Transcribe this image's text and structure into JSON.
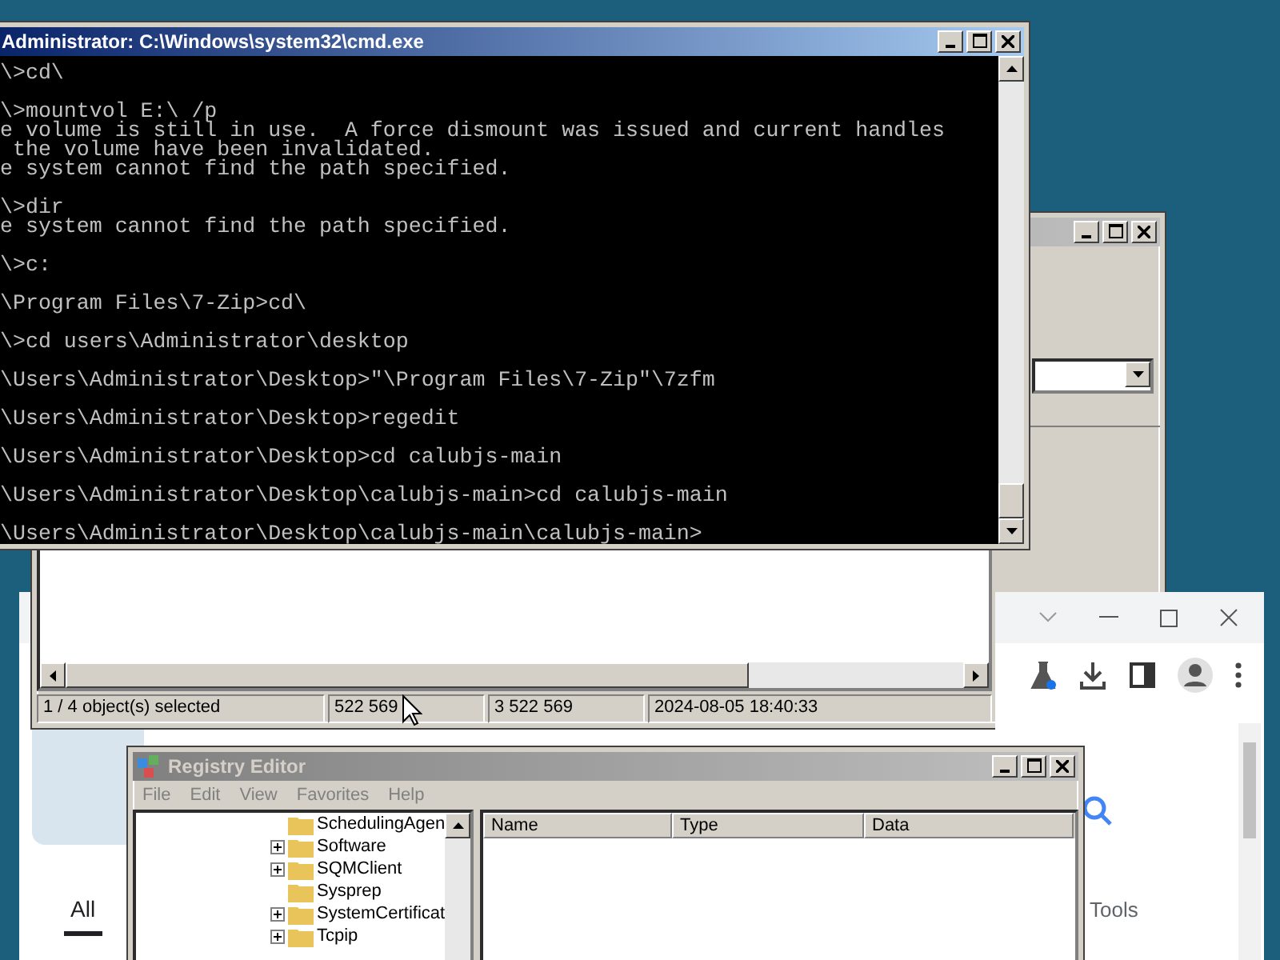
{
  "browser_window": {
    "tabs": [
      {
        "label": "All",
        "selected": true
      }
    ],
    "tools_link": "Tools"
  },
  "sevenzip_window": {
    "active": false,
    "status_bar": [
      "1 / 4 object(s) selected",
      "522 569",
      "3 522 569",
      "2024-08-05 18:40:33"
    ]
  },
  "cmd_window": {
    "active": true,
    "title": "Administrator: C:\\Windows\\system32\\cmd.exe",
    "console_text": "\\>cd\\\n\n\\>mountvol E:\\ /p\ne volume is still in use.  A force dismount was issued and current handles\n the volume have been invalidated.\ne system cannot find the path specified.\n\n\\>dir\ne system cannot find the path specified.\n\n\\>c:\n\n\\Program Files\\7-Zip>cd\\\n\n\\>cd users\\Administrator\\desktop\n\n\\Users\\Administrator\\Desktop>\"\\Program Files\\7-Zip\"\\7zfm\n\n\\Users\\Administrator\\Desktop>regedit\n\n\\Users\\Administrator\\Desktop>cd calubjs-main\n\n\\Users\\Administrator\\Desktop\\calubjs-main>cd calubjs-main\n\n\\Users\\Administrator\\Desktop\\calubjs-main\\calubjs-main>"
  },
  "registry_window": {
    "active": false,
    "title": "Registry Editor",
    "menu": [
      "File",
      "Edit",
      "View",
      "Favorites",
      "Help"
    ],
    "tree": [
      {
        "label": "SchedulingAgen",
        "expandable": false
      },
      {
        "label": "Software",
        "expandable": true
      },
      {
        "label": "SQMClient",
        "expandable": true
      },
      {
        "label": "Sysprep",
        "expandable": false
      },
      {
        "label": "SystemCertificat",
        "expandable": true
      },
      {
        "label": "Tcpip",
        "expandable": true
      }
    ],
    "columns": [
      "Name",
      "Type",
      "Data"
    ]
  }
}
